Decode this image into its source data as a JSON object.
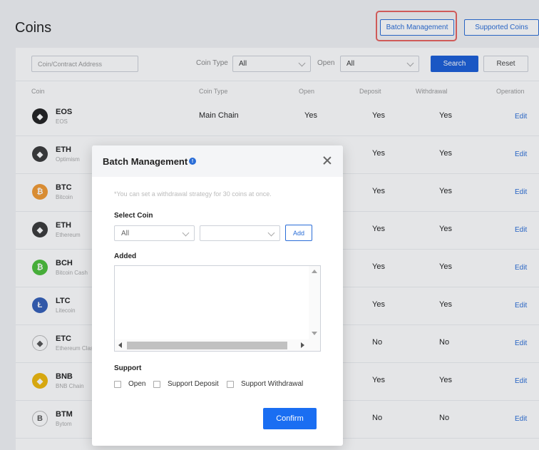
{
  "page": {
    "title": "Coins"
  },
  "header_buttons": {
    "batch": "Batch Management",
    "supported": "Supported Coins"
  },
  "filters": {
    "address_placeholder": "Coin/Contract Address",
    "coin_type_label": "Coin Type",
    "coin_type_value": "All",
    "open_label": "Open",
    "open_value": "All",
    "search": "Search",
    "reset": "Reset"
  },
  "table": {
    "headers": [
      "Coin",
      "Coin Type",
      "Open",
      "Deposit",
      "Withdrawal",
      "Operation"
    ],
    "rows": [
      {
        "symbol": "EOS",
        "name": "EOS",
        "type": "Main Chain",
        "open": "Yes",
        "deposit": "Yes",
        "withdrawal": "Yes",
        "op": "Edit",
        "icon": "eos-icon",
        "color": "#222222"
      },
      {
        "symbol": "ETH",
        "name": "Optimism",
        "type": "",
        "open": "",
        "deposit": "Yes",
        "withdrawal": "Yes",
        "op": "Edit",
        "icon": "eth-optimism-icon",
        "color": "#3a3a3a"
      },
      {
        "symbol": "BTC",
        "name": "Bitcoin",
        "type": "",
        "open": "",
        "deposit": "Yes",
        "withdrawal": "Yes",
        "op": "Edit",
        "icon": "btc-icon",
        "color": "#f29a33"
      },
      {
        "symbol": "ETH",
        "name": "Ethereum",
        "type": "",
        "open": "",
        "deposit": "Yes",
        "withdrawal": "Yes",
        "op": "Edit",
        "icon": "eth-icon",
        "color": "#3a3a3a"
      },
      {
        "symbol": "BCH",
        "name": "Bitcoin Cash",
        "type": "",
        "open": "",
        "deposit": "Yes",
        "withdrawal": "Yes",
        "op": "Edit",
        "icon": "bch-icon",
        "color": "#4cc03a"
      },
      {
        "symbol": "LTC",
        "name": "Litecoin",
        "type": "",
        "open": "",
        "deposit": "Yes",
        "withdrawal": "Yes",
        "op": "Edit",
        "icon": "ltc-icon",
        "color": "#345fb8"
      },
      {
        "symbol": "ETC",
        "name": "Ethereum Classic",
        "type": "",
        "open": "",
        "deposit": "No",
        "withdrawal": "No",
        "op": "Edit",
        "icon": "etc-icon",
        "color": "#ffffff"
      },
      {
        "symbol": "BNB",
        "name": "BNB Chain",
        "type": "",
        "open": "",
        "deposit": "Yes",
        "withdrawal": "Yes",
        "op": "Edit",
        "icon": "bnb-icon",
        "color": "#f0b90b"
      },
      {
        "symbol": "BTM",
        "name": "Bytom",
        "type": "",
        "open": "",
        "deposit": "No",
        "withdrawal": "No",
        "op": "Edit",
        "icon": "btm-icon",
        "color": "#ffffff"
      }
    ]
  },
  "modal": {
    "title": "Batch Management",
    "hint": "*You can set a withdrawal strategy for 30 coins at once.",
    "select_coin_label": "Select Coin",
    "select_first_value": "All",
    "select_second_value": "",
    "add": "Add",
    "added_label": "Added",
    "support_label": "Support",
    "options": [
      "Open",
      "Support Deposit",
      "Support Withdrawal"
    ],
    "confirm": "Confirm"
  }
}
